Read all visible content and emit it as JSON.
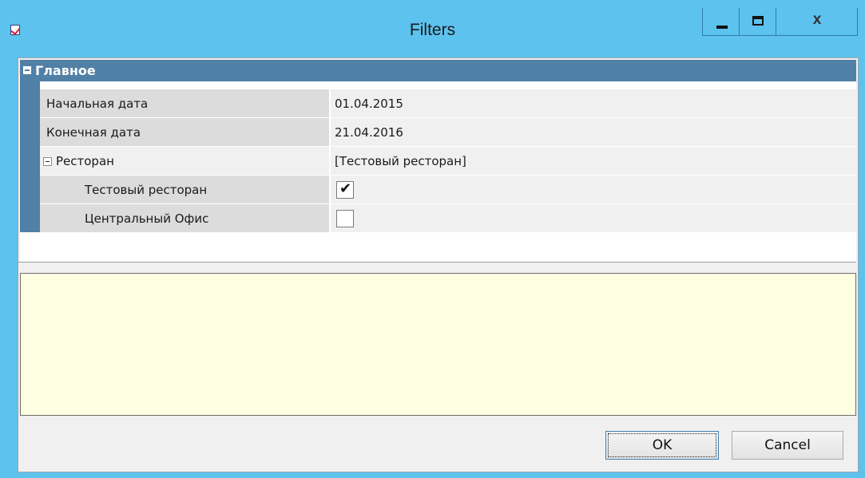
{
  "window": {
    "title": "Filters",
    "icon": "checkbox-app-icon",
    "controls": {
      "minimize": "minimize-icon",
      "maximize": "maximize-icon",
      "close_label": "x"
    }
  },
  "property_grid": {
    "category": {
      "label": "Главное",
      "expanded": true
    },
    "rows": [
      {
        "name": "Начальная дата",
        "value": "01.04.2015"
      },
      {
        "name": "Конечная дата",
        "value": "21.04.2016"
      },
      {
        "name": "Ресторан",
        "value": "[Тестовый ресторан]",
        "expanded": true
      },
      {
        "name": "Тестовый ресторан",
        "checked": true,
        "check_glyph": "✔"
      },
      {
        "name": "Центральный Офис",
        "checked": false
      }
    ]
  },
  "buttons": {
    "ok": "OK",
    "cancel": "Cancel"
  },
  "colors": {
    "titlebar": "#5dc2ee",
    "category_header": "#5180a7",
    "help_panel": "#ffffe1",
    "name_cell": "#dcdcdc"
  }
}
